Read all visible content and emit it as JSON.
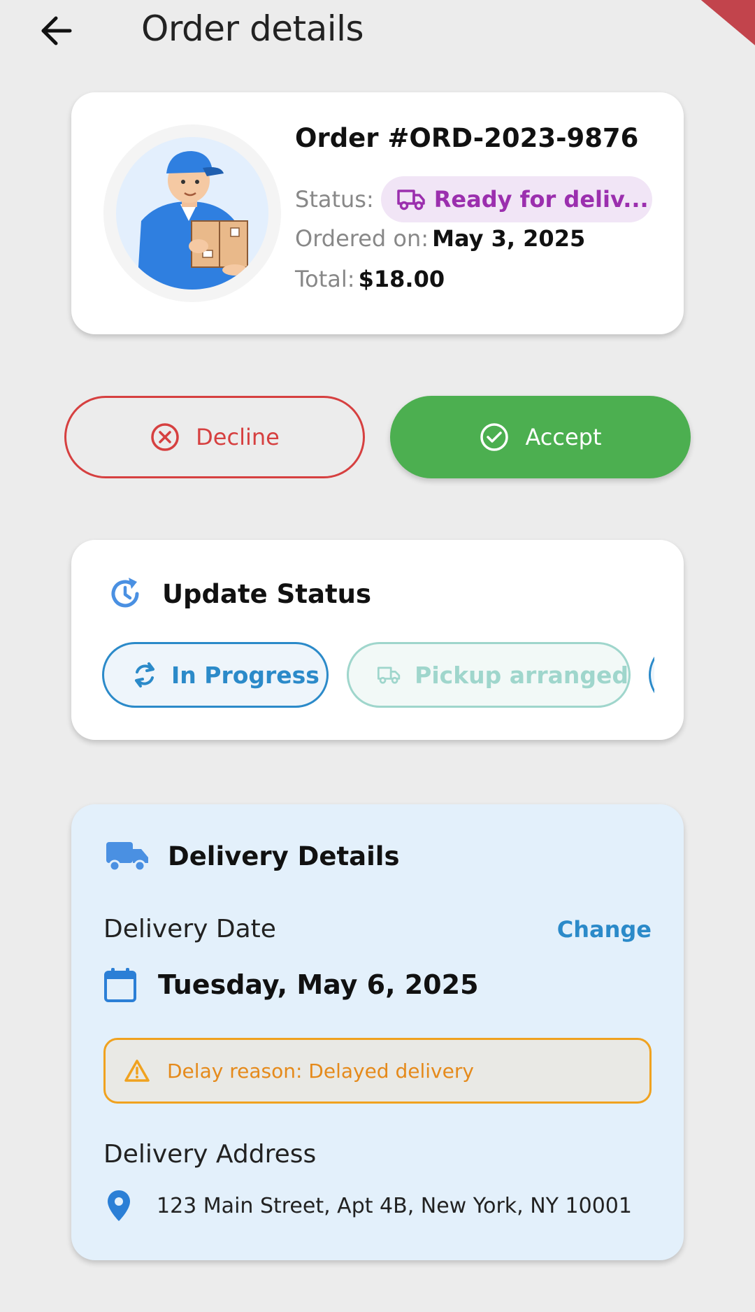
{
  "header": {
    "title": "Order details"
  },
  "order": {
    "id_label": "Order #ORD-2023-9876",
    "status_label": "Status:",
    "status_value": "Ready for deliv...",
    "ordered_label": "Ordered on:",
    "ordered_value": "May 3, 2025",
    "total_label": "Total:",
    "total_value": "$18.00"
  },
  "actions": {
    "decline_label": "Decline",
    "accept_label": "Accept"
  },
  "update_status": {
    "title": "Update Status",
    "chips": [
      {
        "label": "In Progress"
      },
      {
        "label": "Pickup arranged"
      }
    ]
  },
  "delivery": {
    "title": "Delivery Details",
    "date_label": "Delivery Date",
    "change_label": "Change",
    "date_value": "Tuesday, May 6, 2025",
    "delay_text": "Delay reason: Delayed delivery",
    "address_label": "Delivery Address",
    "address_value": "123 Main Street, Apt 4B, New York, NY 10001"
  },
  "colors": {
    "background": "#ececec",
    "status_purple": "#9b2fae",
    "decline_red": "#d64040",
    "accept_green": "#4caf50",
    "primary_blue": "#2b8ac9",
    "pickup_teal": "#9fd6cc",
    "warning_orange": "#f0a21f",
    "delivery_card_bg": "#e3f0fb"
  },
  "icons": {
    "back": "arrow-left-icon",
    "status": "truck-icon",
    "decline": "x-circle-icon",
    "accept": "check-circle-icon",
    "update_status": "history-clock-icon",
    "in_progress": "sync-icon",
    "pickup": "truck-outline-icon",
    "delivery": "truck-filled-icon",
    "date": "calendar-icon",
    "warning": "warning-triangle-icon",
    "address": "location-pin-icon"
  }
}
